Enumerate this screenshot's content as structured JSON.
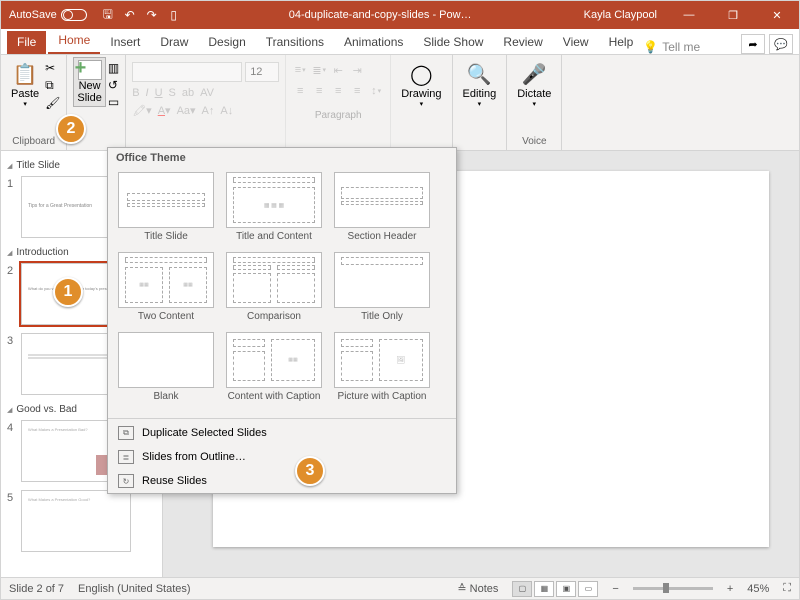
{
  "titlebar": {
    "autosave": "AutoSave",
    "doctitle": "04-duplicate-and-copy-slides - Pow…",
    "user": "Kayla Claypool"
  },
  "tabs": [
    "File",
    "Home",
    "Insert",
    "Draw",
    "Design",
    "Transitions",
    "Animations",
    "Slide Show",
    "Review",
    "View",
    "Help"
  ],
  "tellme": "Tell me",
  "ribbon": {
    "clipboard": {
      "paste": "Paste",
      "label": "Clipboard"
    },
    "slides": {
      "new_slide": "New\nSlide"
    },
    "font": {
      "size": "12"
    },
    "paragraph": {
      "label": "Paragraph"
    },
    "drawing": {
      "btn": "Drawing",
      "label": ""
    },
    "editing": {
      "btn": "Editing"
    },
    "voice": {
      "btn": "Dictate",
      "label": "Voice"
    }
  },
  "gallery": {
    "title": "Office Theme",
    "layouts": [
      "Title Slide",
      "Title and Content",
      "Section Header",
      "Two Content",
      "Comparison",
      "Title Only",
      "Blank",
      "Content with Caption",
      "Picture with Caption"
    ],
    "duplicate": "Duplicate Selected Slides",
    "outline": "Slides from Outline…",
    "reuse": "Reuse Slides"
  },
  "sections": {
    "s1": "Title Slide",
    "s2": "Introduction",
    "s3": "Good vs. Bad"
  },
  "canvas_text": "know after today's",
  "statusbar": {
    "slidecount": "Slide 2 of 7",
    "lang": "English (United States)",
    "notes": "Notes",
    "zoom": "45%"
  },
  "callouts": {
    "c1": "1",
    "c2": "2",
    "c3": "3"
  }
}
